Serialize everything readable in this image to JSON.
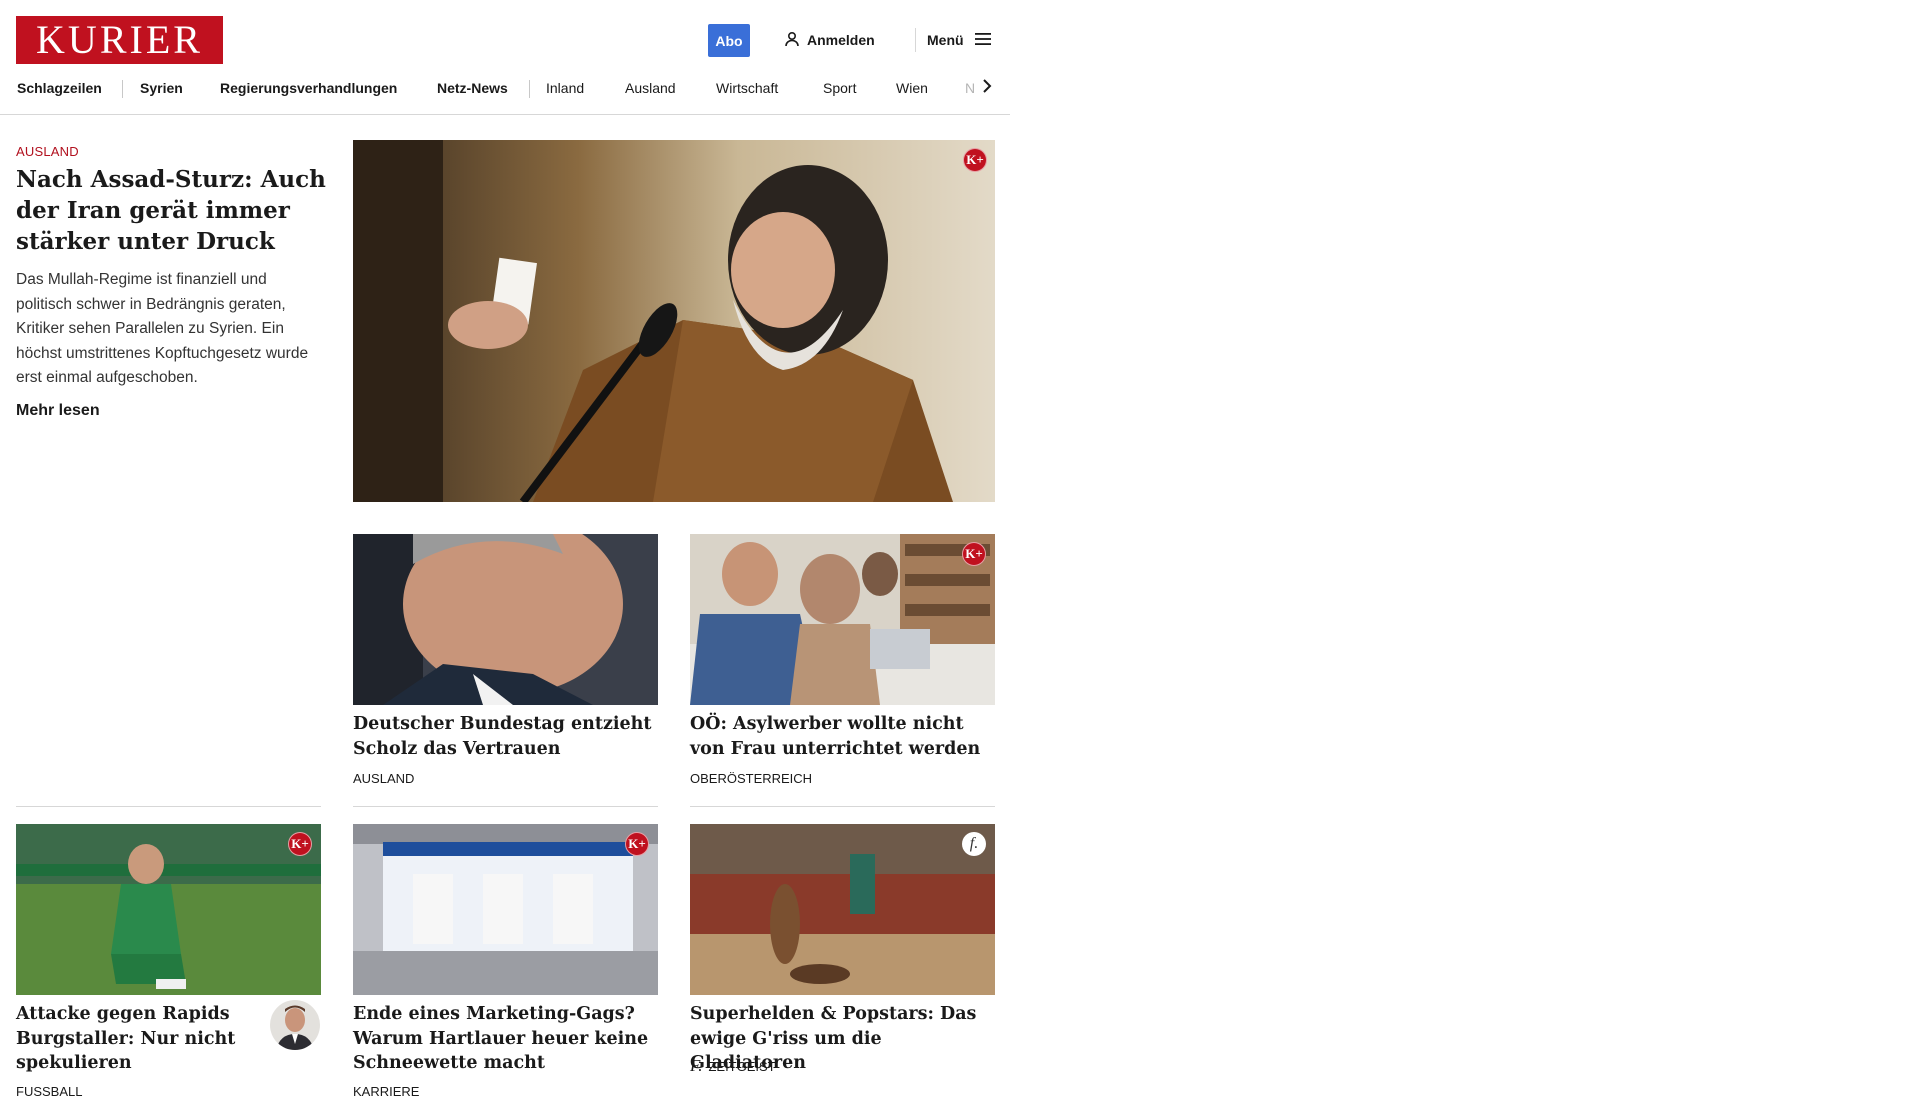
{
  "header": {
    "logo": "KURIER",
    "abo": "Abo",
    "login": "Anmelden",
    "menu": "Menü"
  },
  "nav": {
    "items": [
      "Schlagzeilen",
      "Syrien",
      "Regierungsverhandlungen",
      "Netz-News",
      "Inland",
      "Ausland",
      "Wirtschaft",
      "Sport",
      "Wien",
      "NÖ"
    ]
  },
  "lead": {
    "kicker": "AUSLAND",
    "title": "Nach Assad-Sturz: Auch der Iran gerät immer stär­ker unter Druck",
    "teaser": "Das Mullah-Regime ist finanziell und politisch schwer in Bedrängnis geraten, Kritiker sehen Parallelen zu Syrien. Ein höchst umstrittenes Kopftuchgesetz wurde erst einmal aufgeschoben.",
    "read_more": "Mehr lesen",
    "badge": "K+"
  },
  "cards": [
    {
      "title": "Deutscher Bundestag entzieht Scholz das Vertrauen",
      "category": "AUSLAND"
    },
    {
      "title": "OÖ: Asylwerber wollte nicht von Frau unterrichtet werden",
      "category": "OBERÖSTERREICH",
      "badge": "K+"
    },
    {
      "title": "Attacke gegen Rapids Burgstaller: Nur nicht spekulieren",
      "category": "FUSSBALL",
      "badge": "K+"
    },
    {
      "title": "Ende eines Marketing-Gags? Warum Hartlauer heuer keine Schneewette macht",
      "category": "KARRIERE",
      "badge": "K+"
    },
    {
      "title": "Superhelden & Popstars: Das ewige G'riss um die Gladiatoren",
      "category": "ZEITGEIST",
      "badge": "f."
    }
  ],
  "colors": {
    "brand": "#c0111f",
    "abo": "#3a6fd8",
    "kicker": "#b1101e"
  },
  "icons": [
    "user-icon",
    "hamburger-icon",
    "chevron-right-icon",
    "kplus-badge-icon",
    "zeitgeist-icon"
  ]
}
